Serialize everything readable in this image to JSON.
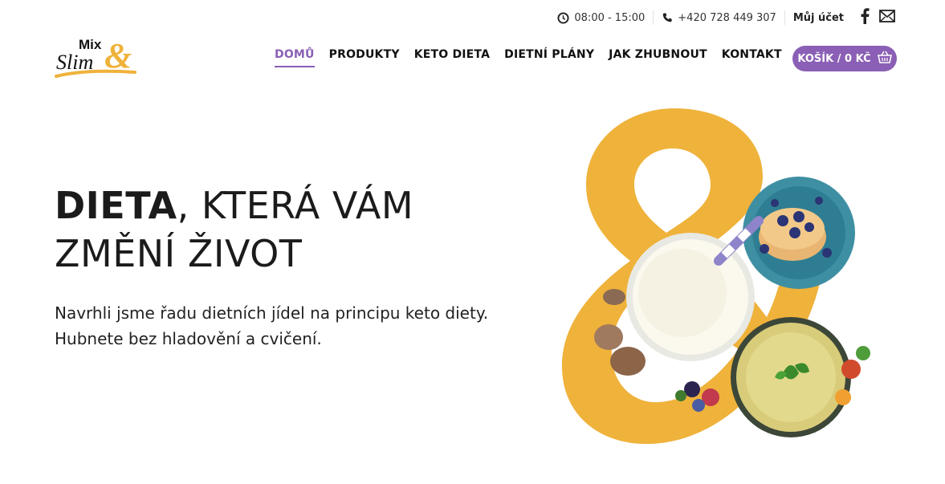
{
  "topbar": {
    "hours": "08:00 - 15:00",
    "phone": "+420 728 449 307",
    "account": "Můj účet",
    "social": [
      "facebook-icon",
      "mail-icon"
    ]
  },
  "logo": {
    "line1": "Mix",
    "line2": "Slim",
    "ampersand": "&"
  },
  "nav": {
    "items": [
      {
        "label": "DOMŮ",
        "active": true
      },
      {
        "label": "PRODUKTY",
        "active": false
      },
      {
        "label": "KETO DIETA",
        "active": false
      },
      {
        "label": "DIETNÍ PLÁNY",
        "active": false
      },
      {
        "label": "JAK ZHUBNOUT",
        "active": false
      },
      {
        "label": "KONTAKT",
        "active": false
      }
    ],
    "cart": "KOŠÍK / 0 KČ"
  },
  "hero": {
    "title_bold": "DIETA",
    "title_rest_1": ", KTERÁ VÁM",
    "title_line2": "ZMĚNÍ ŽIVOT",
    "subtitle_line1": "Navrhli jsme řadu dietních jídel na principu keto diety.",
    "subtitle_line2": "Hubnete bez hladovění a cvičení."
  },
  "colors": {
    "accent": "#8a5fb5",
    "brand_yellow": "#efb23a",
    "text": "#1b1b1b"
  }
}
